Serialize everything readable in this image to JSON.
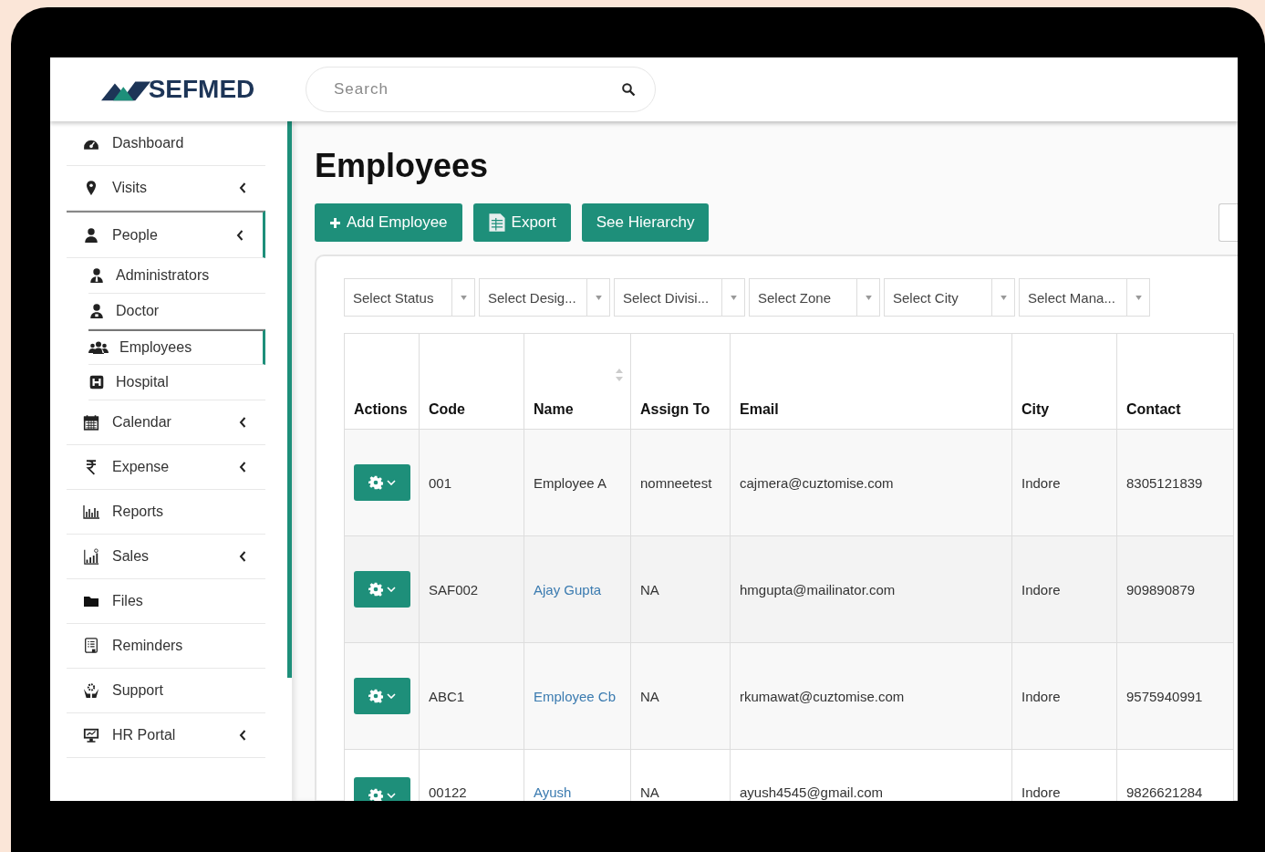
{
  "logo": {
    "text": "SEFMED"
  },
  "search": {
    "placeholder": "Search"
  },
  "sidebar": {
    "items": [
      {
        "label": "Dashboard",
        "kind": "dashboard",
        "expandable": false,
        "selected": false
      },
      {
        "label": "Visits",
        "kind": "pin",
        "expandable": true,
        "selected": false
      },
      {
        "label": "People",
        "kind": "person",
        "expandable": true,
        "selected": true,
        "children": [
          {
            "label": "Administrators",
            "kind": "admin",
            "selected": false
          },
          {
            "label": "Doctor",
            "kind": "doctor",
            "selected": false
          },
          {
            "label": "Employees",
            "kind": "group",
            "selected": true
          },
          {
            "label": "Hospital",
            "kind": "hospital",
            "selected": false
          }
        ]
      },
      {
        "label": "Calendar",
        "kind": "calendar",
        "expandable": true,
        "selected": false
      },
      {
        "label": "Expense",
        "kind": "rupee",
        "expandable": true,
        "selected": false
      },
      {
        "label": "Reports",
        "kind": "bars",
        "expandable": false,
        "selected": false
      },
      {
        "label": "Sales",
        "kind": "sales",
        "expandable": true,
        "selected": false
      },
      {
        "label": "Files",
        "kind": "folder",
        "expandable": false,
        "selected": false
      },
      {
        "label": "Reminders",
        "kind": "list",
        "expandable": false,
        "selected": false
      },
      {
        "label": "Support",
        "kind": "support",
        "expandable": false,
        "selected": false
      },
      {
        "label": "HR Portal",
        "kind": "monitor",
        "expandable": true,
        "selected": false
      }
    ]
  },
  "page": {
    "title": "Employees"
  },
  "buttons": [
    {
      "label": "Add Employee",
      "kind": "plus"
    },
    {
      "label": "Export",
      "kind": "sheet"
    },
    {
      "label": "See Hierarchy",
      "kind": "plain"
    }
  ],
  "filters": [
    "Select Status",
    "Select Desig...",
    "Select Divisi...",
    "Select Zone",
    "Select City",
    "Select Mana..."
  ],
  "table": {
    "columns": [
      {
        "label": "Actions",
        "sortable": false
      },
      {
        "label": "Code",
        "sortable": false
      },
      {
        "label": "Name",
        "sortable": true
      },
      {
        "label": "Assign To",
        "sortable": false
      },
      {
        "label": "Email",
        "sortable": false
      },
      {
        "label": "City",
        "sortable": false
      },
      {
        "label": "Contact",
        "sortable": false
      }
    ],
    "rows": [
      {
        "code": "001",
        "name": "Employee A",
        "name_link": false,
        "assign_to": "nomneetest",
        "email": "cajmera@cuztomise.com",
        "city": "Indore",
        "contact": "8305121839"
      },
      {
        "code": "SAF002",
        "name": "Ajay Gupta",
        "name_link": true,
        "assign_to": "NA",
        "email": "hmgupta@mailinator.com",
        "city": "Indore",
        "contact": "909890879"
      },
      {
        "code": "ABC1",
        "name": "Employee Cb",
        "name_link": true,
        "assign_to": "NA",
        "email": "rkumawat@cuztomise.com",
        "city": "Indore",
        "contact": "9575940991"
      },
      {
        "code": "00122",
        "name": "Ayush",
        "name_link": true,
        "assign_to": "NA",
        "email": "ayush4545@gmail.com",
        "city": "Indore",
        "contact": "9826621284"
      }
    ]
  }
}
